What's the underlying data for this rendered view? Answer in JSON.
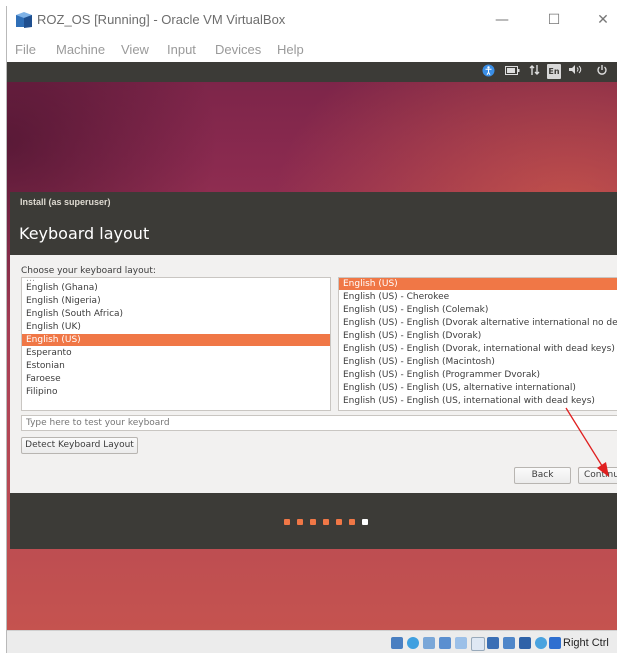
{
  "window": {
    "title": "ROZ_OS [Running] - Oracle VM VirtualBox",
    "controls": {
      "minimize": "—",
      "maximize": "☐",
      "close": "✕"
    }
  },
  "menubar": {
    "items": [
      "File",
      "Machine",
      "View",
      "Input",
      "Devices",
      "Help"
    ]
  },
  "guest_topbar": {
    "keyboard_indicator": "En",
    "icons": [
      "accessibility-icon",
      "battery-icon",
      "network-icon",
      "keyboard-indicator-icon",
      "volume-icon",
      "power-icon"
    ]
  },
  "installer": {
    "subtitle": "Install (as superuser)",
    "title": "Keyboard layout",
    "choose_label": "Choose your keyboard layout:",
    "layouts": [
      "English (Ghana)",
      "English (Nigeria)",
      "English (South Africa)",
      "English (UK)",
      "English (US)",
      "Esperanto",
      "Estonian",
      "Faroese",
      "Filipino"
    ],
    "selected_layout": "English (US)",
    "variants": [
      "English (US)",
      "English (US) - Cherokee",
      "English (US) - English (Colemak)",
      "English (US) - English (Dvorak alternative international no dead",
      "English (US) - English (Dvorak)",
      "English (US) - English (Dvorak, international with dead keys)",
      "English (US) - English (Macintosh)",
      "English (US) - English (Programmer Dvorak)",
      "English (US) - English (US, alternative international)",
      "English (US) - English (US, international with dead keys)"
    ],
    "selected_variant": "English (US)",
    "test_placeholder": "Type here to test your keyboard",
    "detect_button": "Detect Keyboard Layout",
    "back_button": "Back",
    "continue_button": "Continue",
    "progress": {
      "total_steps": 7,
      "current_step": 7
    }
  },
  "statusbar": {
    "host_key": "Right Ctrl"
  },
  "colors": {
    "accent": "#f07746",
    "dark": "#3c3b37",
    "annotation_arrow": "#e02020"
  }
}
